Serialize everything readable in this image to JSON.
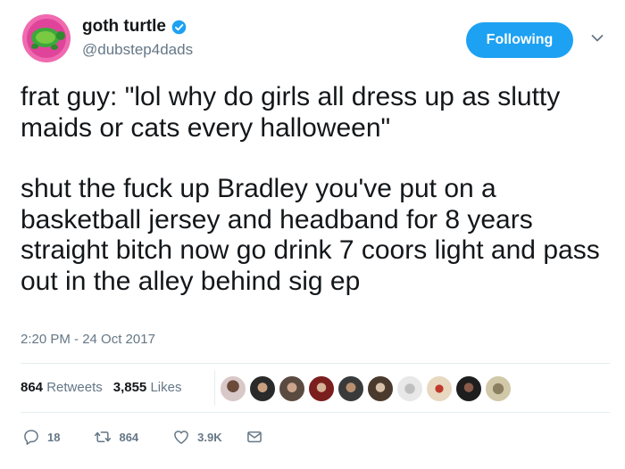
{
  "user": {
    "name": "goth turtle",
    "handle": "@dubstep4dads"
  },
  "follow_label": "Following",
  "tweet": {
    "paragraph1": "frat guy: \"lol why do girls all dress up as slutty maids or cats every halloween\"",
    "paragraph2": "shut the fuck up Bradley you've put on a basketball jersey and headband for 8 years straight bitch now go drink 7 coors light and pass out in the alley behind sig ep"
  },
  "timestamp": "2:20 PM - 24 Oct 2017",
  "stats": {
    "retweets_count": "864",
    "retweets_label": "Retweets",
    "likes_count": "3,855",
    "likes_label": "Likes"
  },
  "actions": {
    "replies": "18",
    "retweets": "864",
    "likes": "3.9K"
  },
  "colors": {
    "accent": "#1da1f2",
    "muted": "#657786",
    "text": "#14171a"
  }
}
